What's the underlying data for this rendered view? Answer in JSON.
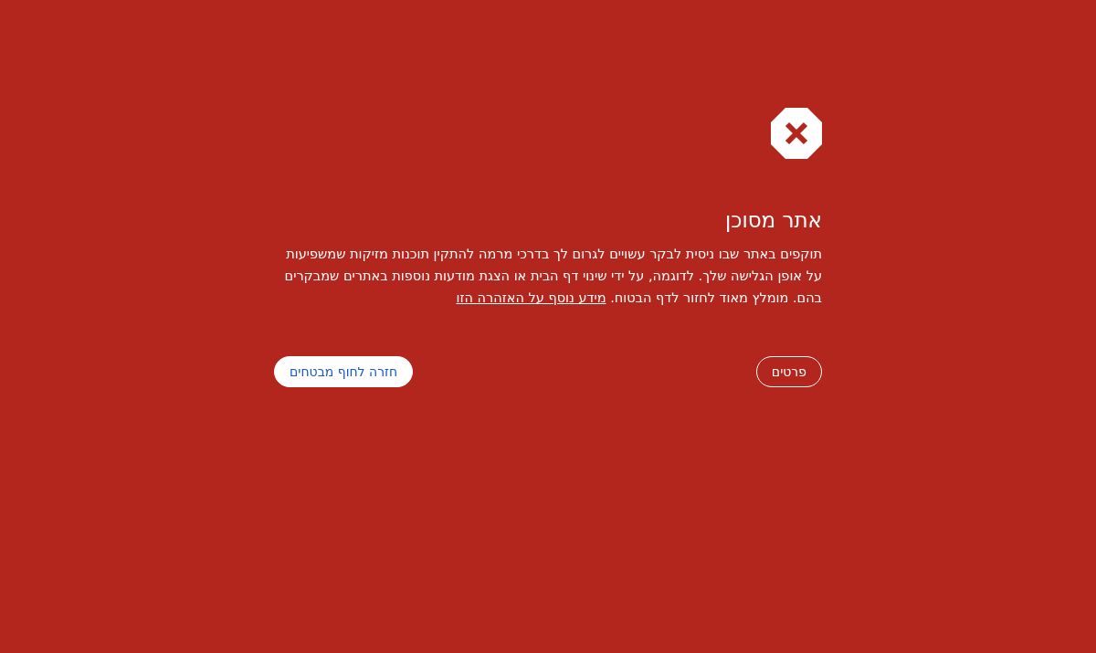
{
  "title": "אתר מסוכן",
  "message": {
    "text": "תוקפים באתר שבו ניסית לבקר עשויים לגרום לך בדרכי מרמה להתקין תוכנות מזיקות שמשפיעות על אופן הגלישה שלך. לדוגמה, על ידי שינוי דף הבית או הצגת מודעות נוספות באתרים שמבקרים בהם. מומלץ מאוד לחזור לדף הבטוח.",
    "link": "מידע נוסף על האזהרה הזו"
  },
  "buttons": [
    {
      "label": "פרטים",
      "kind": "outline"
    },
    {
      "label": "חזרה לחוף מבטחים",
      "kind": "primary"
    }
  ]
}
